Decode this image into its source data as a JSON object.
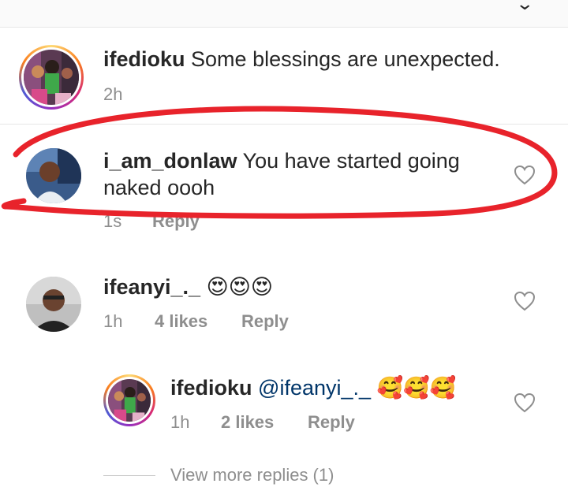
{
  "post": {
    "username": "ifedioku",
    "caption": "Some blessings are unexpected.",
    "time": "2h"
  },
  "comments": [
    {
      "username": "i_am_donlaw",
      "text_line1": "You have started going",
      "text_line2": "naked oooh",
      "time": "1s",
      "reply": "Reply"
    },
    {
      "username": "ifeanyi_._",
      "emojis": "😍😍😍",
      "time": "1h",
      "likes": "4 likes",
      "reply": "Reply"
    }
  ],
  "replies": [
    {
      "username": "ifedioku",
      "mention": "@ifeanyi_._",
      "emojis": "🥰🥰🥰",
      "time": "1h",
      "likes": "2 likes",
      "reply": "Reply"
    }
  ],
  "view_more": "View more replies (1)",
  "colors": {
    "mention": "#003569",
    "annotation": "#e8232b",
    "meta": "#8e8e8e"
  }
}
